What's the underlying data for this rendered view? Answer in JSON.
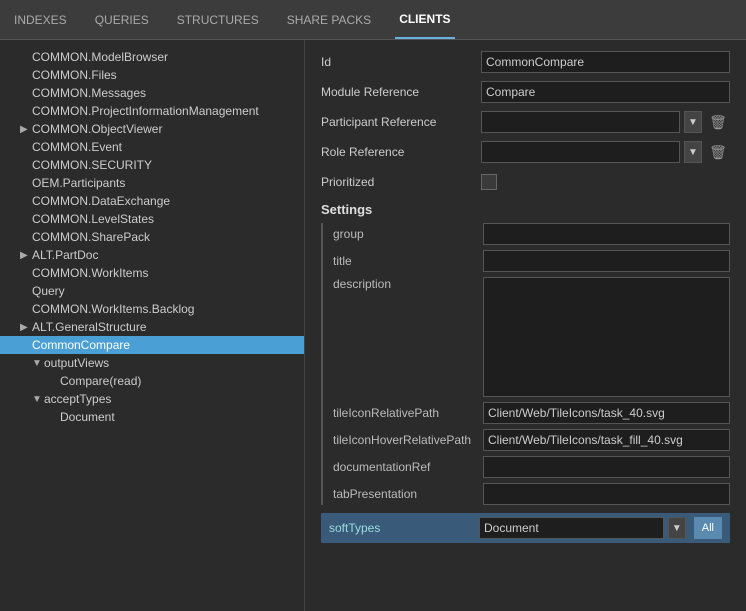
{
  "nav": {
    "items": [
      {
        "label": "INDEXES",
        "active": false
      },
      {
        "label": "QUERIES",
        "active": false
      },
      {
        "label": "STRUCTURES",
        "active": false
      },
      {
        "label": "SHARE PACKS",
        "active": false
      },
      {
        "label": "CLIENTS",
        "active": true
      }
    ]
  },
  "tree": {
    "items": [
      {
        "label": "COMMON.ModelBrowser",
        "indent": 1,
        "arrow": "",
        "selected": false
      },
      {
        "label": "COMMON.Files",
        "indent": 1,
        "arrow": "",
        "selected": false
      },
      {
        "label": "COMMON.Messages",
        "indent": 1,
        "arrow": "",
        "selected": false
      },
      {
        "label": "COMMON.ProjectInformationManagement",
        "indent": 1,
        "arrow": "",
        "selected": false
      },
      {
        "label": "COMMON.ObjectViewer",
        "indent": 1,
        "arrow": "▶",
        "selected": false
      },
      {
        "label": "COMMON.Event",
        "indent": 1,
        "arrow": "",
        "selected": false
      },
      {
        "label": "COMMON.SECURITY",
        "indent": 1,
        "arrow": "",
        "selected": false
      },
      {
        "label": "OEM.Participants",
        "indent": 1,
        "arrow": "",
        "selected": false
      },
      {
        "label": "COMMON.DataExchange",
        "indent": 1,
        "arrow": "",
        "selected": false
      },
      {
        "label": "COMMON.LevelStates",
        "indent": 1,
        "arrow": "",
        "selected": false
      },
      {
        "label": "COMMON.SharePack",
        "indent": 1,
        "arrow": "",
        "selected": false
      },
      {
        "label": "ALT.PartDoc",
        "indent": 1,
        "arrow": "▶",
        "selected": false
      },
      {
        "label": "COMMON.WorkItems",
        "indent": 1,
        "arrow": "",
        "selected": false
      },
      {
        "label": "Query",
        "indent": 1,
        "arrow": "",
        "selected": false
      },
      {
        "label": "COMMON.WorkItems.Backlog",
        "indent": 1,
        "arrow": "",
        "selected": false
      },
      {
        "label": "ALT.GeneralStructure",
        "indent": 1,
        "arrow": "▶",
        "selected": false
      },
      {
        "label": "CommonCompare",
        "indent": 1,
        "arrow": "",
        "selected": true
      },
      {
        "label": "outputViews",
        "indent": 2,
        "arrow": "▼",
        "selected": false
      },
      {
        "label": "Compare(read)",
        "indent": 3,
        "arrow": "",
        "selected": false
      },
      {
        "label": "acceptTypes",
        "indent": 2,
        "arrow": "▼",
        "selected": false
      },
      {
        "label": "Document",
        "indent": 3,
        "arrow": "",
        "selected": false
      }
    ]
  },
  "form": {
    "id_label": "Id",
    "id_value": "CommonCompare",
    "module_ref_label": "Module Reference",
    "module_ref_value": "Compare",
    "participant_ref_label": "Participant Reference",
    "participant_ref_value": "",
    "role_ref_label": "Role Reference",
    "role_ref_value": "",
    "prioritized_label": "Prioritized",
    "settings_header": "Settings",
    "group_label": "group",
    "group_value": "",
    "title_label": "title",
    "title_value": "",
    "description_label": "description",
    "description_value": "",
    "tile_icon_label": "tileIconRelativePath",
    "tile_icon_value": "Client/Web/TileIcons/task_40.svg",
    "tile_icon_hover_label": "tileIconHoverRelativePath",
    "tile_icon_hover_value": "Client/Web/TileIcons/task_fill_40.svg",
    "doc_ref_label": "documentationRef",
    "doc_ref_value": "",
    "tab_presentation_label": "tabPresentation",
    "tab_presentation_value": "",
    "soft_types_label": "softTypes",
    "soft_types_value": "Document",
    "all_btn_label": "All",
    "participant_options": [
      ""
    ],
    "role_options": [
      ""
    ],
    "soft_types_options": [
      "Document"
    ]
  },
  "icons": {
    "arrow_down": "▼",
    "arrow_right": "▶",
    "delete": "🗑",
    "expand": "▼"
  }
}
